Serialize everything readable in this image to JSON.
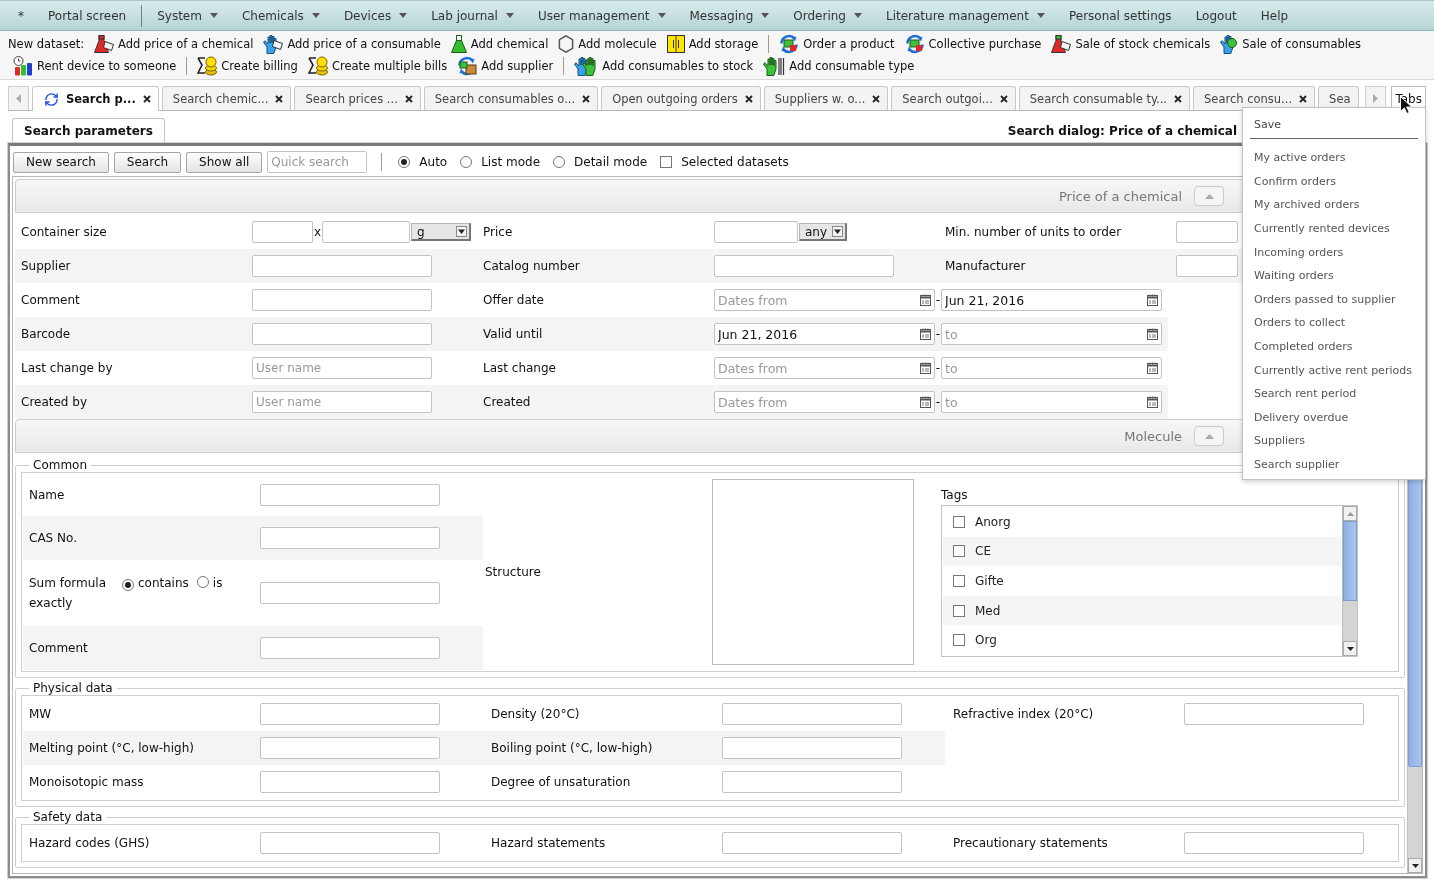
{
  "menu_bar": [
    {
      "kind": "link",
      "label": "*"
    },
    {
      "kind": "link",
      "label": "Portal screen"
    },
    {
      "kind": "separator"
    },
    {
      "kind": "menu",
      "label": "System"
    },
    {
      "kind": "menu",
      "label": "Chemicals"
    },
    {
      "kind": "menu",
      "label": "Devices"
    },
    {
      "kind": "menu",
      "label": "Lab journal"
    },
    {
      "kind": "menu",
      "label": "User management"
    },
    {
      "kind": "menu",
      "label": "Messaging"
    },
    {
      "kind": "menu",
      "label": "Ordering"
    },
    {
      "kind": "menu",
      "label": "Literature management"
    },
    {
      "kind": "link",
      "label": "Personal settings"
    },
    {
      "kind": "link",
      "label": "Logout"
    },
    {
      "kind": "link",
      "label": "Help"
    }
  ],
  "toolbar": {
    "label": "New dataset:",
    "items": [
      {
        "kind": "button",
        "label": "Add price of a chemical"
      },
      {
        "kind": "button",
        "label": "Add price of a consumable"
      },
      {
        "kind": "button",
        "label": "Add chemical"
      },
      {
        "kind": "button",
        "label": "Add molecule"
      },
      {
        "kind": "button",
        "label": "Add storage"
      },
      {
        "kind": "separator"
      },
      {
        "kind": "button",
        "label": "Order a product"
      },
      {
        "kind": "button",
        "label": "Collective purchase"
      },
      {
        "kind": "button",
        "label": "Sale of stock chemicals"
      },
      {
        "kind": "button",
        "label": "Sale of consumables"
      },
      {
        "kind": "button",
        "label": "Rent device to someone"
      },
      {
        "kind": "separator"
      },
      {
        "kind": "button",
        "label": "Create billing"
      },
      {
        "kind": "button",
        "label": "Create multiple bills"
      },
      {
        "kind": "button",
        "label": "Add supplier"
      },
      {
        "kind": "separator"
      },
      {
        "kind": "button",
        "label": "Add consumables to stock"
      },
      {
        "kind": "button",
        "label": "Add consumable type"
      }
    ]
  },
  "tab_bar": {
    "tabs": [
      {
        "label": "Search p...",
        "selected": true,
        "closable": true
      },
      {
        "label": "Search chemic...",
        "selected": false,
        "closable": true
      },
      {
        "label": "Search prices ...",
        "selected": false,
        "closable": true
      },
      {
        "label": "Search consumables o...",
        "selected": false,
        "closable": true
      },
      {
        "label": "Open outgoing orders",
        "selected": false,
        "closable": true
      },
      {
        "label": "Suppliers w. o...",
        "selected": false,
        "closable": true
      },
      {
        "label": "Search outgoi...",
        "selected": false,
        "closable": true
      },
      {
        "label": "Search consumable ty...",
        "selected": false,
        "closable": true
      },
      {
        "label": "Search consu...",
        "selected": false,
        "closable": true
      },
      {
        "label": "Sea",
        "selected": false,
        "closable": false
      }
    ],
    "menu_button": "Tabs"
  },
  "tabs_menu": {
    "items": [
      {
        "kind": "command",
        "label": "Save"
      },
      {
        "kind": "link",
        "label": "My active orders"
      },
      {
        "kind": "link",
        "label": "Confirm orders"
      },
      {
        "kind": "link",
        "label": "My archived orders"
      },
      {
        "kind": "link",
        "label": "Currently rented devices"
      },
      {
        "kind": "link",
        "label": "Incoming orders"
      },
      {
        "kind": "link",
        "label": "Waiting orders"
      },
      {
        "kind": "link",
        "label": "Orders passed to supplier"
      },
      {
        "kind": "link",
        "label": "Orders to collect"
      },
      {
        "kind": "link",
        "label": "Completed orders"
      },
      {
        "kind": "link",
        "label": "Currently active rent periods"
      },
      {
        "kind": "link",
        "label": "Search rent period"
      },
      {
        "kind": "link",
        "label": "Delivery overdue"
      },
      {
        "kind": "link",
        "label": "Suppliers"
      },
      {
        "kind": "link",
        "label": "Search supplier"
      }
    ]
  },
  "panel": {
    "tab": {
      "label": "Search parameters",
      "selected": true
    },
    "title": "Search dialog: Price of a chemical"
  },
  "search_toolbar": {
    "buttons": [
      "New search",
      "Search",
      "Show all"
    ],
    "quick_search": {
      "placeholder": "Quick search"
    },
    "view_modes": [
      {
        "label": "Auto",
        "selected": true
      },
      {
        "label": "List mode",
        "selected": false
      },
      {
        "label": "Detail mode",
        "selected": false
      }
    ],
    "selected_datasets": {
      "label": "Selected datasets",
      "checked": false
    }
  },
  "sections": [
    {
      "kind": "grid",
      "title": "Price of a chemical",
      "expanded": true,
      "rows": [
        [
          {
            "kind": "label",
            "text": "Container size"
          },
          {
            "kind": "size",
            "separator": "x",
            "unit": "g"
          },
          {
            "kind": "label",
            "text": "Price"
          },
          {
            "kind": "price",
            "option": "any"
          },
          {
            "kind": "label",
            "text": "Min. number of units to order"
          },
          {
            "kind": "input"
          }
        ],
        [
          {
            "kind": "label",
            "text": "Supplier"
          },
          {
            "kind": "input"
          },
          {
            "kind": "label",
            "text": "Catalog number"
          },
          {
            "kind": "input"
          },
          {
            "kind": "label",
            "text": "Manufacturer"
          },
          {
            "kind": "input"
          }
        ],
        [
          {
            "kind": "label",
            "text": "Comment"
          },
          {
            "kind": "input"
          },
          {
            "kind": "label",
            "text": "Offer date"
          },
          {
            "kind": "daterange",
            "from": {
              "placeholder": "Dates from"
            },
            "dash": "-",
            "to": {
              "value": "Jun 21, 2016"
            }
          }
        ],
        [
          {
            "kind": "label",
            "text": "Barcode"
          },
          {
            "kind": "input"
          },
          {
            "kind": "label",
            "text": "Valid until"
          },
          {
            "kind": "daterange",
            "from": {
              "value": "Jun 21, 2016"
            },
            "dash": "-",
            "to": {
              "placeholder": "to"
            }
          }
        ],
        [
          {
            "kind": "label",
            "text": "Last change by"
          },
          {
            "kind": "input",
            "placeholder": "User name"
          },
          {
            "kind": "label",
            "text": "Last change"
          },
          {
            "kind": "daterange",
            "from": {
              "placeholder": "Dates from"
            },
            "dash": "-",
            "to": {
              "placeholder": "to"
            }
          }
        ],
        [
          {
            "kind": "label",
            "text": "Created by"
          },
          {
            "kind": "input",
            "placeholder": "User name"
          },
          {
            "kind": "label",
            "text": "Created"
          },
          {
            "kind": "daterange",
            "from": {
              "placeholder": "Dates from"
            },
            "dash": "-",
            "to": {
              "placeholder": "to"
            }
          }
        ]
      ]
    },
    {
      "kind": "groups",
      "title": "Molecule",
      "expanded": true,
      "groups": [
        {
          "kind": "common",
          "legend": "Common",
          "fields": [
            {
              "label": "Name"
            },
            {
              "label": "CAS No."
            },
            {
              "label": "Sum formula",
              "options": [
                {
                  "label": "contains",
                  "selected": true
                },
                {
                  "label": "is exactly",
                  "selected": false
                }
              ]
            },
            {
              "label": "Comment"
            }
          ],
          "structure": {
            "label": "Structure"
          },
          "tags": {
            "label": "Tags",
            "items": [
              {
                "label": "Anorg",
                "checked": false
              },
              {
                "label": "CE",
                "checked": false
              },
              {
                "label": "Gifte",
                "checked": false
              },
              {
                "label": "Med",
                "checked": false
              },
              {
                "label": "Org",
                "checked": false
              }
            ]
          }
        },
        {
          "kind": "grid",
          "legend": "Physical data",
          "rows": [
            [
              {
                "kind": "label",
                "text": "MW"
              },
              {
                "kind": "input"
              },
              {
                "kind": "label",
                "text": "Density (20°C)"
              },
              {
                "kind": "input"
              },
              {
                "kind": "label",
                "text": "Refractive index (20°C)"
              },
              {
                "kind": "input"
              }
            ],
            [
              {
                "kind": "label",
                "text": "Melting point (°C, low-high)"
              },
              {
                "kind": "input"
              },
              {
                "kind": "label",
                "text": "Boiling point (°C, low-high)"
              },
              {
                "kind": "input"
              }
            ],
            [
              {
                "kind": "label",
                "text": "Monoisotopic mass"
              },
              {
                "kind": "input"
              },
              {
                "kind": "label",
                "text": "Degree of unsaturation"
              },
              {
                "kind": "input"
              }
            ]
          ]
        },
        {
          "kind": "grid",
          "legend": "Safety data",
          "rows": [
            [
              {
                "kind": "label",
                "text": "Hazard codes (GHS)"
              },
              {
                "kind": "input"
              },
              {
                "kind": "label",
                "text": "Hazard statements"
              },
              {
                "kind": "input"
              },
              {
                "kind": "label",
                "text": "Precautionary statements"
              },
              {
                "kind": "input"
              }
            ]
          ]
        }
      ]
    }
  ]
}
